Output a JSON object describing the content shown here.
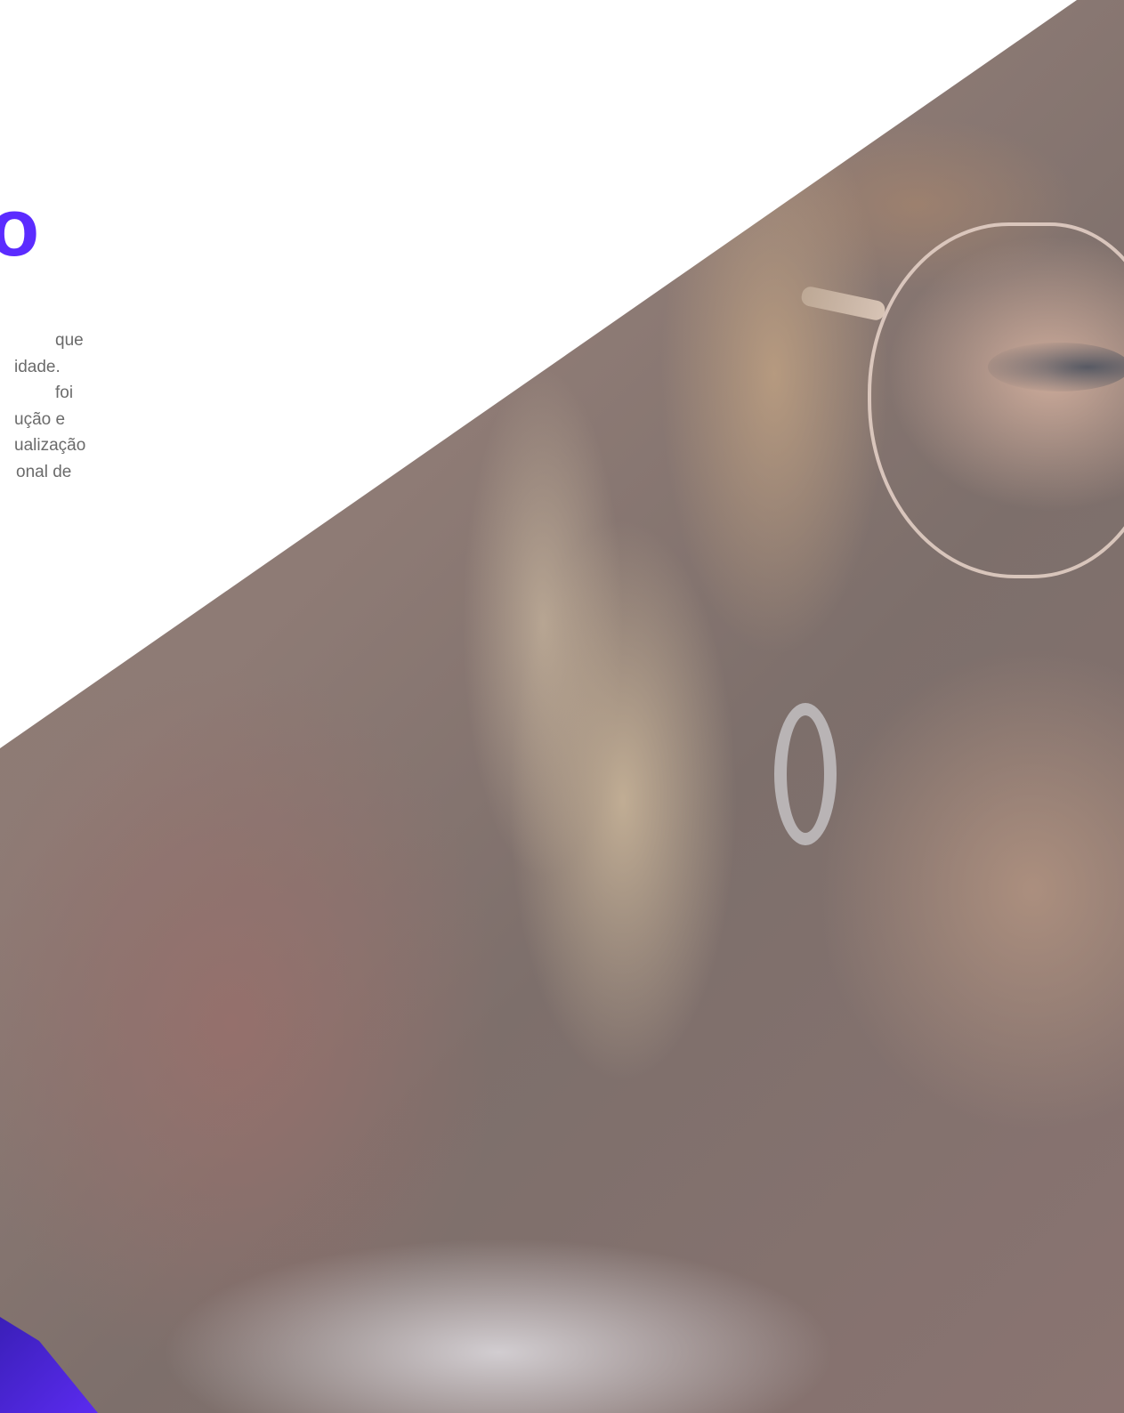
{
  "hero": {
    "headline": "o",
    "paragraph_lines": [
      "que",
      "idade.",
      "foi",
      "ução e",
      "ualização",
      "onal de"
    ]
  },
  "colors": {
    "accent": "#5b2bff",
    "text": "#6b6b6b",
    "corner": "#4a25d6"
  }
}
